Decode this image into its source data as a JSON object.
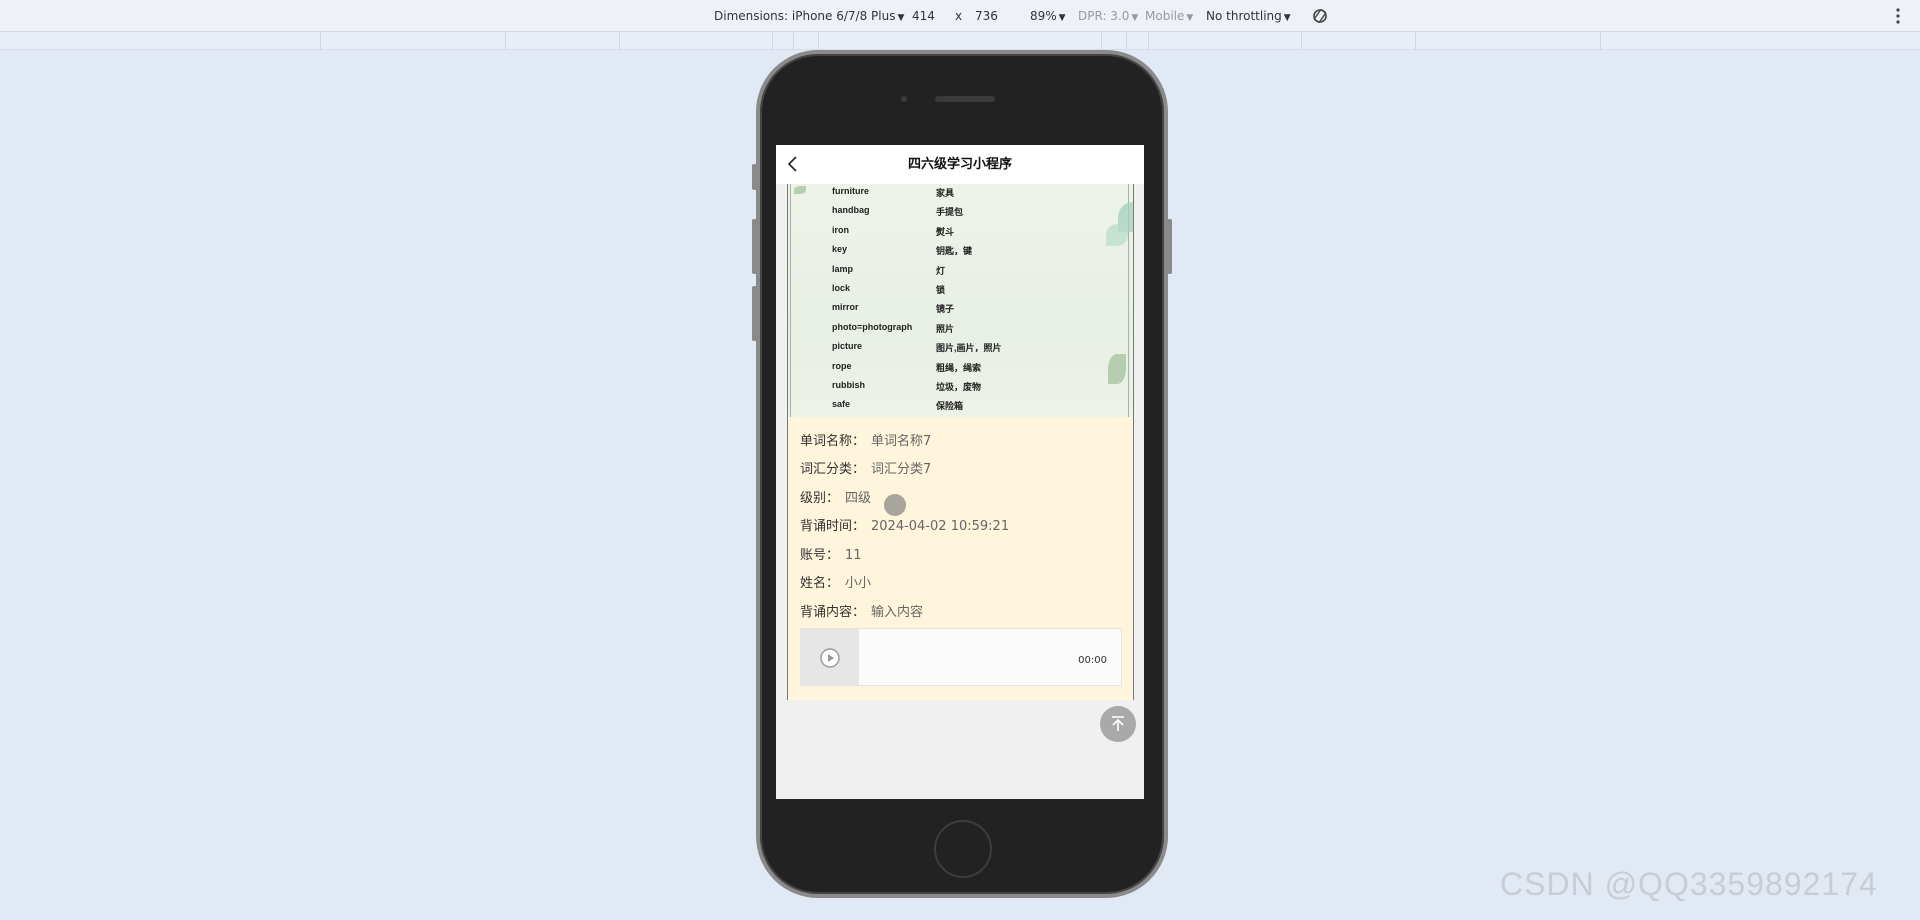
{
  "devtools": {
    "dimensions_label": "Dimensions: iPhone 6/7/8 Plus",
    "width": "414",
    "times": "x",
    "height": "736",
    "zoom": "89%",
    "dpr": "DPR: 3.0",
    "mobile": "Mobile",
    "throttling": "No throttling"
  },
  "app": {
    "title": "四六级学习小程序"
  },
  "vocab_list": [
    {
      "en": "furniture",
      "zh": "家具"
    },
    {
      "en": "handbag",
      "zh": "手提包"
    },
    {
      "en": "iron",
      "zh": "熨斗"
    },
    {
      "en": "key",
      "zh": "钥匙，键"
    },
    {
      "en": "lamp",
      "zh": "灯"
    },
    {
      "en": "lock",
      "zh": "锁"
    },
    {
      "en": "mirror",
      "zh": "镜子"
    },
    {
      "en": "photo=photograph",
      "zh": "照片"
    },
    {
      "en": "picture",
      "zh": "图片,画片，照片"
    },
    {
      "en": "rope",
      "zh": "粗绳，绳索"
    },
    {
      "en": "rubbish",
      "zh": "垃圾，废物"
    },
    {
      "en": "safe",
      "zh": "保险箱"
    }
  ],
  "details": [
    {
      "label": "单词名称：",
      "value": "单词名称7"
    },
    {
      "label": "词汇分类：",
      "value": "词汇分类7"
    },
    {
      "label": "级别：",
      "value": "四级"
    },
    {
      "label": "背诵时间：",
      "value": "2024-04-02 10:59:21"
    },
    {
      "label": "账号：",
      "value": "11"
    },
    {
      "label": "姓名：",
      "value": "小小"
    },
    {
      "label": "背诵内容：",
      "value": "输入内容"
    }
  ],
  "audio": {
    "time": "00:00"
  },
  "watermark": "CSDN @QQ3359892174",
  "colors": {
    "page_bg": "#e1e9f5",
    "content_bg": "#fff4dc",
    "phone_body": "#222222"
  }
}
